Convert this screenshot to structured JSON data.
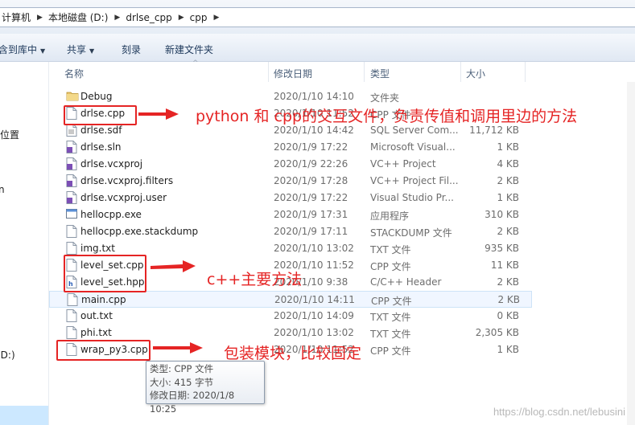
{
  "address": {
    "crumbs": [
      "计算机",
      "本地磁盘 (D:)",
      "drlse_cpp",
      "cpp"
    ],
    "separator": "▶"
  },
  "toolbar": {
    "include_library": "包含到库中",
    "share": "共享",
    "burn": "刻录",
    "new_folder": "新建文件夹",
    "caret": "▼"
  },
  "nav": {
    "items": [
      "的位置",
      "n",
      "(D:)"
    ]
  },
  "columns": {
    "name": "名称",
    "date": "修改日期",
    "type": "类型",
    "size": "大小",
    "sort_indicator": "^"
  },
  "files": [
    {
      "name": "Debug",
      "date": "2020/1/10 14:10",
      "type": "文件夹",
      "size": "",
      "icon": "folder-icon"
    },
    {
      "name": "drlse.cpp",
      "date": "2020/1/10 11:52",
      "type": "CPP 文件",
      "size": "",
      "icon": "cpp-file-icon"
    },
    {
      "name": "drlse.sdf",
      "date": "2020/1/10 14:42",
      "type": "SQL Server Com...",
      "size": "11,712 KB",
      "icon": "sdf-file-icon"
    },
    {
      "name": "drlse.sln",
      "date": "2020/1/9 17:22",
      "type": "Microsoft Visual...",
      "size": "1 KB",
      "icon": "sln-file-icon"
    },
    {
      "name": "drlse.vcxproj",
      "date": "2020/1/9 22:26",
      "type": "VC++ Project",
      "size": "4 KB",
      "icon": "vcxproj-file-icon"
    },
    {
      "name": "drlse.vcxproj.filters",
      "date": "2020/1/9 17:28",
      "type": "VC++ Project Fil...",
      "size": "2 KB",
      "icon": "filters-file-icon"
    },
    {
      "name": "drlse.vcxproj.user",
      "date": "2020/1/9 17:22",
      "type": "Visual Studio Pr...",
      "size": "1 KB",
      "icon": "user-file-icon"
    },
    {
      "name": "hellocpp.exe",
      "date": "2020/1/9 17:31",
      "type": "应用程序",
      "size": "310 KB",
      "icon": "exe-file-icon"
    },
    {
      "name": "hellocpp.exe.stackdump",
      "date": "2020/1/9 17:11",
      "type": "STACKDUMP 文件",
      "size": "2 KB",
      "icon": "stackdump-file-icon"
    },
    {
      "name": "img.txt",
      "date": "2020/1/10 13:02",
      "type": "TXT 文件",
      "size": "935 KB",
      "icon": "txt-file-icon"
    },
    {
      "name": "level_set.cpp",
      "date": "2020/1/10 11:52",
      "type": "CPP 文件",
      "size": "11 KB",
      "icon": "cpp-file-icon"
    },
    {
      "name": "level_set.hpp",
      "date": "2020/1/10 9:38",
      "type": "C/C++ Header",
      "size": "2 KB",
      "icon": "hpp-file-icon"
    },
    {
      "name": "main.cpp",
      "date": "2020/1/10 14:11",
      "type": "CPP 文件",
      "size": "2 KB",
      "icon": "cpp-file-icon"
    },
    {
      "name": "out.txt",
      "date": "2020/1/10 14:09",
      "type": "TXT 文件",
      "size": "0 KB",
      "icon": "txt-file-icon"
    },
    {
      "name": "phi.txt",
      "date": "2020/1/10 13:02",
      "type": "TXT 文件",
      "size": "2,305 KB",
      "icon": "txt-file-icon"
    },
    {
      "name": "wrap_py3.cpp",
      "date": "2020/1/10 11:52",
      "type": "CPP 文件",
      "size": "1 KB",
      "icon": "cpp-file-icon"
    }
  ],
  "annotations": {
    "note1": "python 和 cpp的交互文件，负责传值和调用里边的方法",
    "note2": "c++主要方法",
    "note3": "包装模块，比较固定",
    "color": "#e52424"
  },
  "tooltip": {
    "line1": "类型: CPP 文件",
    "line2": "大小: 415 字节",
    "line3": "修改日期: 2020/1/8 10:25"
  },
  "watermark": "https://blog.csdn.net/lebusini"
}
